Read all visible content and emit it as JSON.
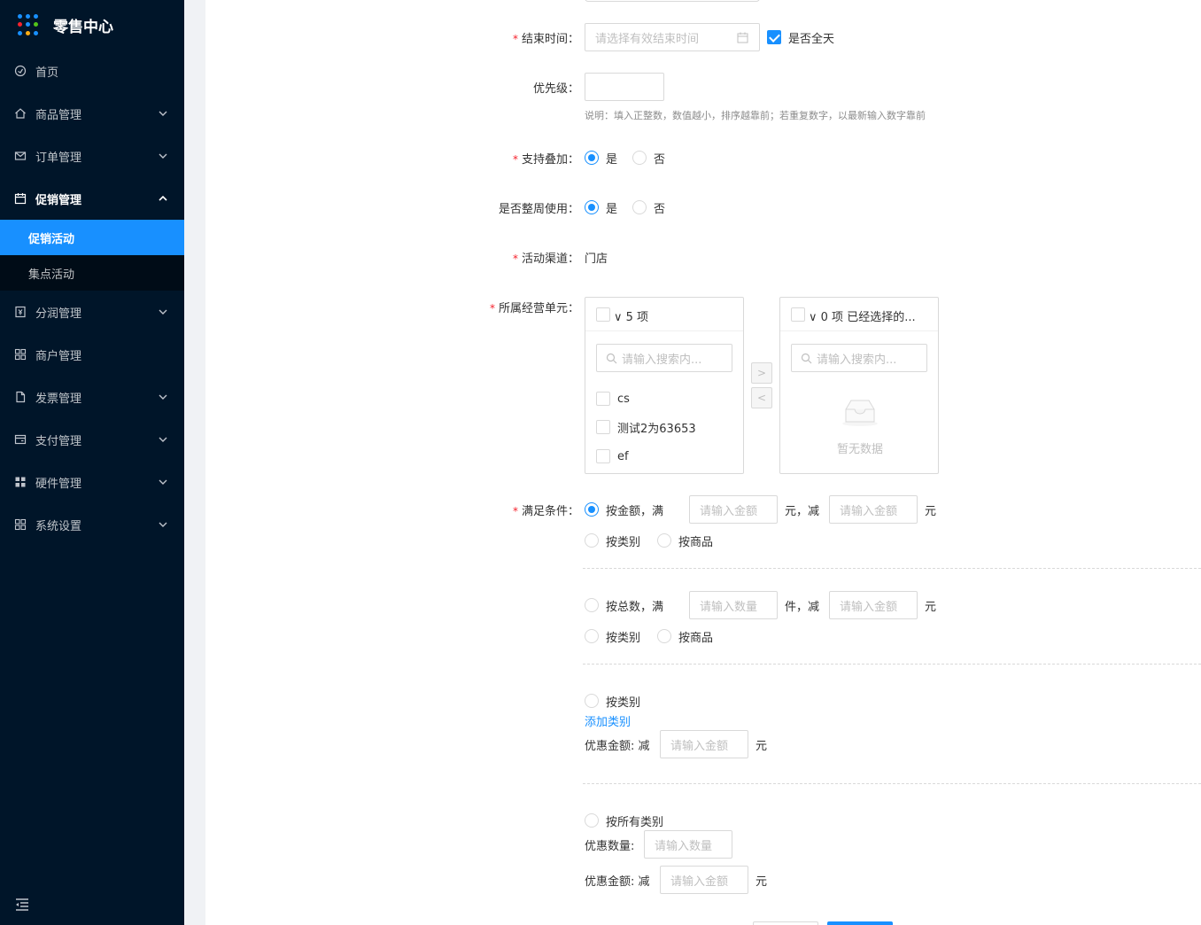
{
  "app": {
    "title": "零售中心"
  },
  "colors": {
    "primary": "#1890ff",
    "sidebar_bg": "#001529",
    "required": "#f5222d"
  },
  "sidebar": {
    "items": [
      {
        "label": "首页",
        "icon": "dashboard-icon"
      },
      {
        "label": "商品管理",
        "icon": "home-icon"
      },
      {
        "label": "订单管理",
        "icon": "mail-icon"
      },
      {
        "label": "促销管理",
        "icon": "calendar-icon",
        "children": [
          {
            "label": "促销活动",
            "active": true
          },
          {
            "label": "集点活动"
          }
        ]
      },
      {
        "label": "分润管理",
        "icon": "yen-icon"
      },
      {
        "label": "商户管理",
        "icon": "appstore-icon"
      },
      {
        "label": "发票管理",
        "icon": "file-icon"
      },
      {
        "label": "支付管理",
        "icon": "wallet-icon"
      },
      {
        "label": "硬件管理",
        "icon": "grid-icon"
      },
      {
        "label": "系统设置",
        "icon": "appstore-icon"
      }
    ]
  },
  "form": {
    "end_time": {
      "label": "结束时间",
      "placeholder": "请选择有效结束时间",
      "allday_label": "是否全天",
      "allday_checked": true
    },
    "priority": {
      "label": "优先级",
      "value": "",
      "hint": "说明：填入正整数，数值越小，排序越靠前；若重复数字，以最新输入数字靠前"
    },
    "stackable": {
      "label": "支持叠加",
      "yes": "是",
      "no": "否",
      "value": "是"
    },
    "weekly": {
      "label": "是否整周使用",
      "yes": "是",
      "no": "否",
      "value": "是"
    },
    "channel": {
      "label": "活动渠道",
      "value": "门店"
    },
    "business_unit": {
      "label": "所属经营单元",
      "left": {
        "header": "5 项",
        "search_placeholder": "请输入搜索内...",
        "items": [
          "cs",
          "测试2为63653",
          "ef"
        ]
      },
      "right": {
        "header": "0 项  已经选择的...",
        "search_placeholder": "请输入搜索内...",
        "empty_text": "暂无数据"
      }
    },
    "condition": {
      "label": "满足条件",
      "by_amount": {
        "label": "按金额，满",
        "amount_placeholder": "请输入金额",
        "unit1": "元，减",
        "discount_placeholder": "请输入金额",
        "unit2": "元",
        "checked": true
      },
      "scope1": {
        "category": "按类别",
        "product": "按商品"
      },
      "by_total": {
        "label": "按总数，满",
        "qty_placeholder": "请输入数量",
        "unit1": "件，减",
        "discount_placeholder": "请输入金额",
        "unit2": "元"
      },
      "scope2": {
        "category": "按类别",
        "product": "按商品"
      },
      "by_category": {
        "label": "按类别",
        "add_link": "添加类别",
        "discount_label": "优惠金额: 减",
        "discount_placeholder": "请输入金额",
        "unit": "元"
      },
      "by_all_category": {
        "label": "按所有类别",
        "qty_label": "优惠数量:",
        "qty_placeholder": "请输入数量",
        "discount_label": "优惠金额: 减",
        "discount_placeholder": "请输入金额",
        "unit": "元"
      }
    }
  }
}
